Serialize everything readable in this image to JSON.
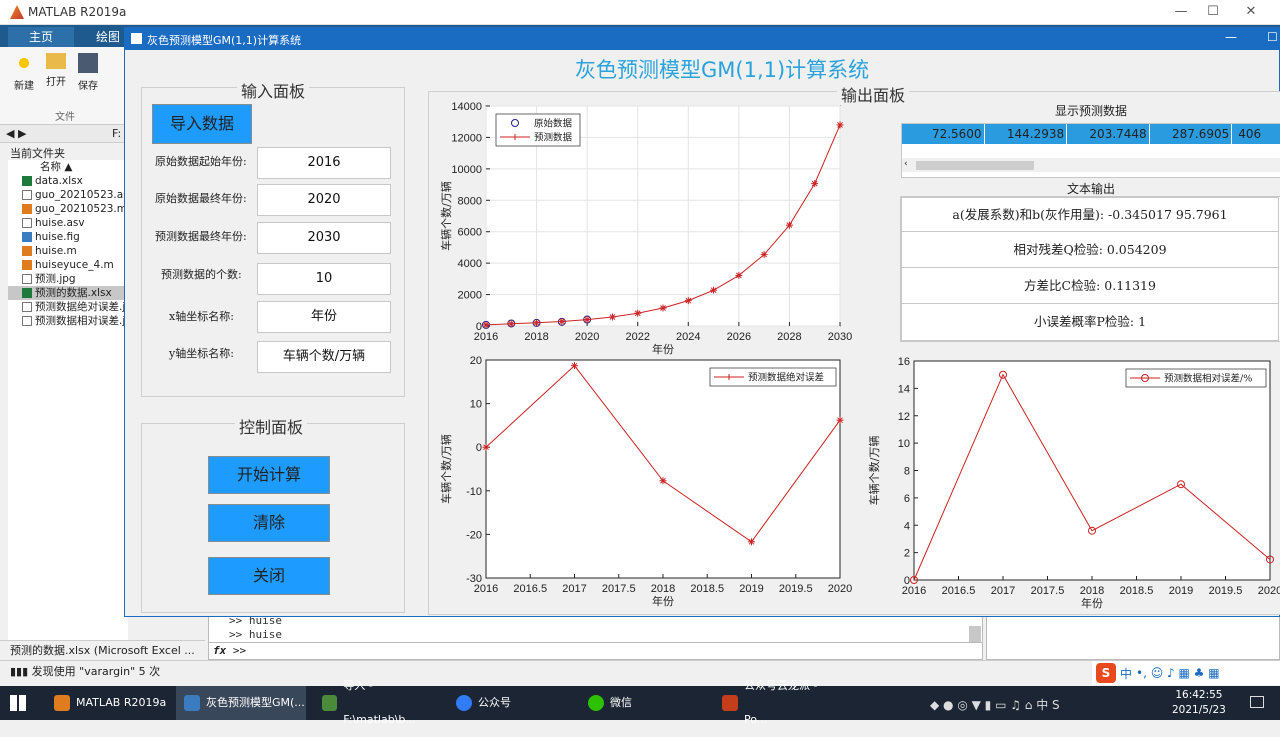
{
  "matlab": {
    "title": "MATLAB R2019a",
    "tabs": [
      "主页",
      "绘图"
    ],
    "tools": [
      "新建",
      "打开",
      "保存"
    ],
    "file_section": "文件",
    "address": "F:",
    "current_folder_label": "当前文件夹",
    "name_header": "名称 ▲",
    "files": [
      "data.xlsx",
      "guo_20210523.asv",
      "guo_20210523.m",
      "huise.asv",
      "huise.fig",
      "huise.m",
      "huiseyuce_4.m",
      "预测.jpg",
      "预测的数据.xlsx",
      "预测数据绝对误差.jpg",
      "预测数据相对误差.jpg"
    ],
    "details": "预测的数据.xlsx (Microsoft Excel ...",
    "status": "发现使用 \"varargin\" 5 次",
    "cmd_lines": [
      ">> huise",
      ">> huise"
    ],
    "prompt": ">>",
    "workspace_item": "huise"
  },
  "app": {
    "window_title": "灰色预测模型GM(1,1)计算系统",
    "main_title": "灰色预测模型GM(1,1)计算系统",
    "input_panel": {
      "title": "输入面板",
      "import_button": "导入数据",
      "fields": [
        {
          "label": "原始数据起始年份:",
          "value": "2016"
        },
        {
          "label": "原始数据最终年份:",
          "value": "2020"
        },
        {
          "label": "预测数据最终年份:",
          "value": "2030"
        },
        {
          "label": "预测数据的个数:",
          "value": "10"
        },
        {
          "label": "x轴坐标名称:",
          "value": "年份"
        },
        {
          "label": "y轴坐标名称:",
          "value": "车辆个数/万辆"
        }
      ]
    },
    "control_panel": {
      "title": "控制面板",
      "start_button": "开始计算",
      "clear_button": "清除",
      "close_button": "关闭"
    },
    "output_panel": {
      "title": "输出面板",
      "table_title": "显示预测数据",
      "table_values": [
        "72.5600",
        "144.2938",
        "203.7448",
        "287.6905",
        "406"
      ],
      "text_output_title": "文本输出",
      "ab_text": "a(发展系数)和b(灰作用量): -0.345017     95.7961",
      "q_text": "相对残差Q检验: 0.054209",
      "c_text": "方差比C检验: 0.11319",
      "p_text": "小误差概率P检验: 1"
    }
  },
  "chart_data": [
    {
      "type": "line",
      "title": "",
      "xlabel": "年份",
      "ylabel": "车辆个数/万辆",
      "xlim": [
        2016,
        2030
      ],
      "ylim": [
        0,
        14000
      ],
      "xticks": [
        2016,
        2018,
        2020,
        2022,
        2024,
        2026,
        2028,
        2030
      ],
      "yticks": [
        0,
        2000,
        4000,
        6000,
        8000,
        10000,
        12000,
        14000
      ],
      "grid": true,
      "legend": "top-left",
      "series": [
        {
          "name": "原始数据",
          "marker": "circle",
          "color": "#1f1f8f",
          "x": [
            2016,
            2017,
            2018,
            2019,
            2020
          ],
          "y": [
            72.56,
            163,
            196,
            266,
            412
          ]
        },
        {
          "name": "预测数据",
          "marker": "star",
          "color": "#cc2222",
          "x": [
            2016,
            2017,
            2018,
            2019,
            2020,
            2021,
            2022,
            2023,
            2024,
            2025,
            2026,
            2027,
            2028,
            2029,
            2030
          ],
          "y": [
            72.56,
            144.29,
            203.74,
            287.69,
            406.2,
            573.6,
            809.9,
            1143.6,
            1614.7,
            2280,
            3219,
            4545,
            6418,
            9062,
            12795
          ]
        }
      ]
    },
    {
      "type": "line",
      "title": "",
      "xlabel": "年份",
      "ylabel": "车辆个数/万辆",
      "xlim": [
        2016,
        2020
      ],
      "ylim": [
        -30,
        20
      ],
      "xticks": [
        2016,
        2016.5,
        2017,
        2017.5,
        2018,
        2018.5,
        2019,
        2019.5,
        2020
      ],
      "yticks": [
        -30,
        -20,
        -10,
        0,
        10,
        20
      ],
      "legend": "top-right",
      "series": [
        {
          "name": "预测数据绝对误差",
          "marker": "star",
          "color": "#cc2222",
          "x": [
            2016,
            2017,
            2018,
            2019,
            2020
          ],
          "y": [
            0,
            18.7,
            -7.7,
            -21.7,
            6.2
          ]
        }
      ]
    },
    {
      "type": "line",
      "title": "",
      "xlabel": "年份",
      "ylabel": "车辆个数/万辆",
      "xlim": [
        2016,
        2020
      ],
      "ylim": [
        0,
        16
      ],
      "xticks": [
        2016,
        2016.5,
        2017,
        2017.5,
        2018,
        2018.5,
        2019,
        2019.5,
        2020
      ],
      "yticks": [
        0,
        2,
        4,
        6,
        8,
        10,
        12,
        14,
        16
      ],
      "legend": "top-right",
      "series": [
        {
          "name": "预测数据相对误差/%",
          "marker": "circle",
          "color": "#cc2222",
          "x": [
            2016,
            2017,
            2018,
            2019,
            2020
          ],
          "y": [
            0,
            15,
            3.6,
            7,
            1.5
          ]
        }
      ]
    }
  ],
  "taskbar": {
    "items": [
      "MATLAB R2019a",
      "灰色预测模型GM(...",
      "导入 - F:\\matlab\\b...",
      "公众号",
      "微信",
      "公众号云龙派 - Po..."
    ],
    "time": "16:42:55",
    "date": "2021/5/23",
    "ime_lang": "中"
  },
  "colors": {
    "accent": "#1e9bff",
    "title_blue": "#2aa3dd",
    "window_bar": "#1a6bc2",
    "table_cell": "#2b9bdf"
  }
}
